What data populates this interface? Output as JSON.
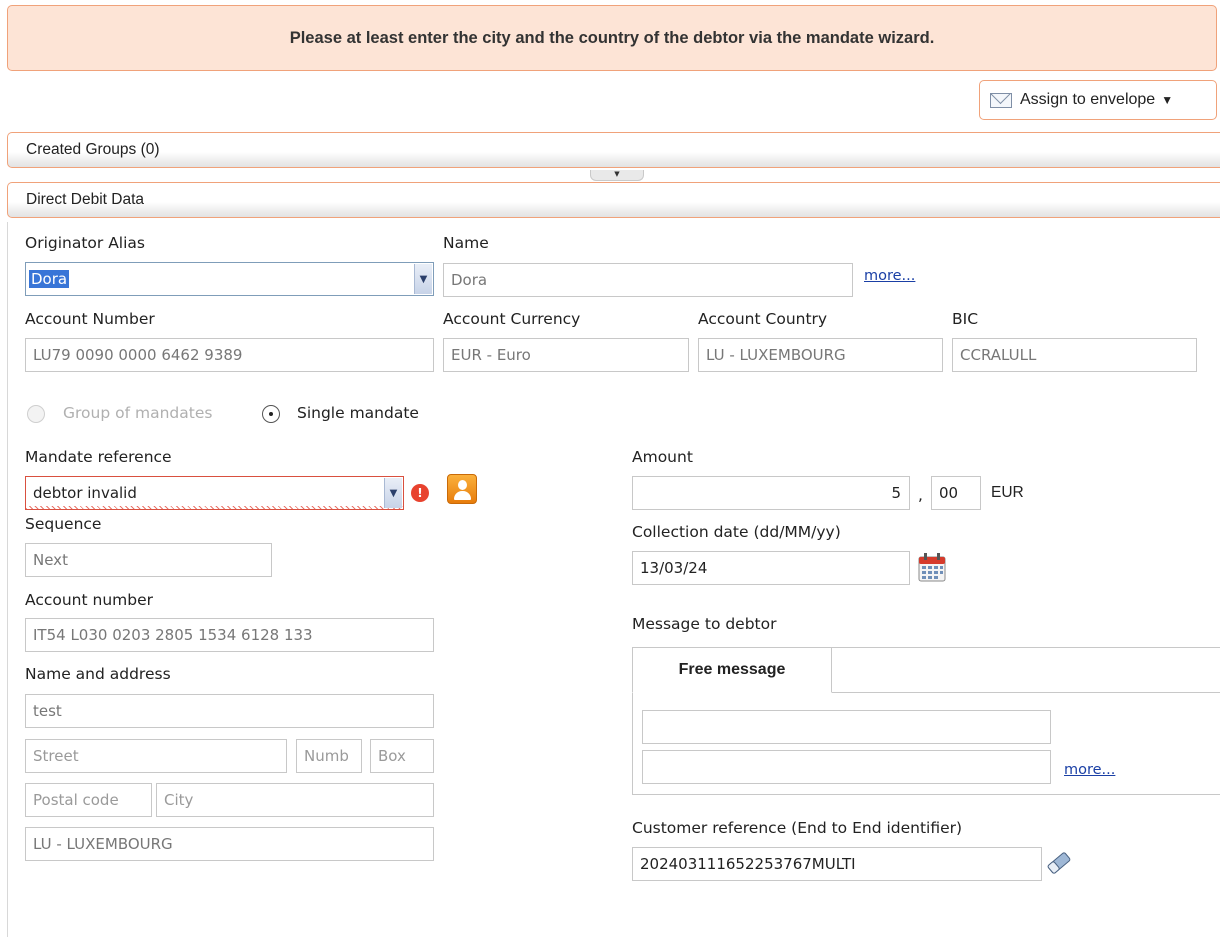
{
  "banner": {
    "message": "Please at least enter the city and the country of the debtor via the mandate wizard."
  },
  "toolbar": {
    "assign_label": "Assign to envelope"
  },
  "sections": {
    "created_groups": "Created Groups (0)",
    "direct_debit": "Direct Debit Data"
  },
  "originator": {
    "alias_label": "Originator Alias",
    "alias_value": "Dora",
    "name_label": "Name",
    "name_value": "Dora",
    "more_link": "more...",
    "account_number_label": "Account Number",
    "account_number_value": "LU79 0090 0000 6462 9389",
    "currency_label": "Account Currency",
    "currency_value": "EUR - Euro",
    "country_label": "Account Country",
    "country_value": "LU - LUXEMBOURG",
    "bic_label": "BIC",
    "bic_value": "CCRALULL"
  },
  "mandate_type": {
    "group_label": "Group of mandates",
    "single_label": "Single mandate",
    "selected": "single"
  },
  "mandate": {
    "reference_label": "Mandate reference",
    "reference_value": "debtor invalid",
    "sequence_label": "Sequence",
    "sequence_value": "Next",
    "account_label": "Account number",
    "account_value": "IT54 L030 0203 2805 1534 6128 133",
    "name_address_label": "Name and address",
    "name_value": "test",
    "street_placeholder": "Street",
    "number_placeholder": "Numb",
    "box_placeholder": "Box",
    "postal_placeholder": "Postal code",
    "city_placeholder": "City",
    "country_value": "LU - LUXEMBOURG"
  },
  "payment": {
    "amount_label": "Amount",
    "amount_units": "5",
    "decimal_sep": ",",
    "amount_cents": "00",
    "currency": "EUR",
    "date_label": "Collection date (dd/MM/yy)",
    "date_value": "13/03/24",
    "message_label": "Message to debtor",
    "free_message_tab": "Free message",
    "message_line1": "",
    "message_line2": "",
    "more_link": "more...",
    "customer_ref_label": "Customer reference (End to End identifier)",
    "customer_ref_value": "202403111652253767MULTI"
  },
  "colors": {
    "accent_border": "#f0a27a",
    "banner_bg": "#fde4d6",
    "error": "#e8432f",
    "link": "#1a3fa5"
  }
}
